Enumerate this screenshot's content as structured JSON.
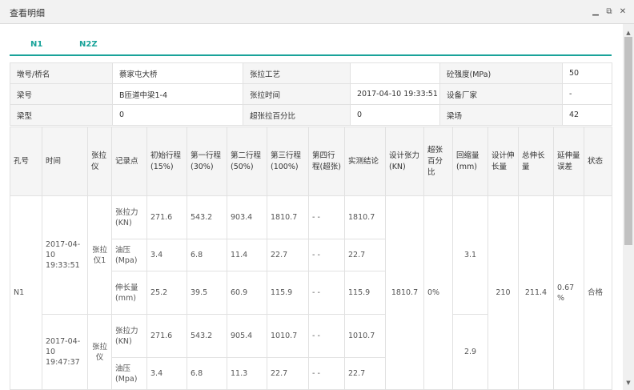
{
  "window": {
    "title": "查看明细",
    "controls": [
      "minimize",
      "maximize",
      "close"
    ]
  },
  "tabs": [
    {
      "label": "N1",
      "active": true
    },
    {
      "label": "N2Z",
      "active": false
    }
  ],
  "info": {
    "row1": {
      "l1": "墩号/桥名",
      "v1": "蔡家屯大桥",
      "l2": "张拉工艺",
      "v2": "",
      "l3": "砼强度(MPa)",
      "v3": "50"
    },
    "row2": {
      "l1": "梁号",
      "v1": "B匝道中梁1-4",
      "l2": "张拉时间",
      "v2": "2017-04-10 19:33:51",
      "l3": "设备厂家",
      "v3": "-"
    },
    "row3": {
      "l1": "梁型",
      "v1": "0",
      "l2": "超张拉百分比",
      "v2": "0",
      "l3": "梁场",
      "v3": "42"
    }
  },
  "headers": {
    "hole": "孔号",
    "time": "时间",
    "device": "张拉仪",
    "point": "记录点",
    "s15": "初始行程(15%)",
    "s30": "第一行程(30%)",
    "s50": "第二行程(50%)",
    "s100": "第三行程(100%)",
    "s4": "第四行程(超张)",
    "measured": "实测结论",
    "design_force": "设计张力(KN)",
    "over_pct": "超张百分比",
    "retract": "回缩量(mm)",
    "design_elong": "设计伸长量",
    "total_elong": "总伸长量",
    "elong_err": "延伸量误差",
    "status": "状态"
  },
  "group": {
    "hole": "N1",
    "design_force": "1810.7",
    "over_pct": "0%",
    "design_elong": "210",
    "total_elong": "211.4",
    "elong_err": "0.67 %",
    "status": "合格",
    "devices": [
      {
        "time": "2017-04-10 19:33:51",
        "name": "张拉仪1",
        "retract": "3.1",
        "rows": [
          {
            "point": "张拉力(KN)",
            "s15": "271.6",
            "s30": "543.2",
            "s50": "903.4",
            "s100": "1810.7",
            "s4": "- -",
            "measured": "1810.7"
          },
          {
            "point": "油压(Mpa)",
            "s15": "3.4",
            "s30": "6.8",
            "s50": "11.4",
            "s100": "22.7",
            "s4": "- -",
            "measured": "22.7"
          },
          {
            "point": "伸长量(mm)",
            "s15": "25.2",
            "s30": "39.5",
            "s50": "60.9",
            "s100": "115.9",
            "s4": "- -",
            "measured": "115.9"
          }
        ]
      },
      {
        "time": "2017-04-10 19:47:37",
        "name": "张拉仪",
        "retract": "2.9",
        "rows": [
          {
            "point": "张拉力(KN)",
            "s15": "271.6",
            "s30": "543.2",
            "s50": "905.4",
            "s100": "1010.7",
            "s4": "- -",
            "measured": "1010.7"
          },
          {
            "point": "油压(Mpa)",
            "s15": "3.4",
            "s30": "6.8",
            "s50": "11.3",
            "s100": "22.7",
            "s4": "- -",
            "measured": "22.7"
          }
        ]
      }
    ]
  },
  "colors": {
    "accent": "#1aa39a",
    "device": "#f0a020",
    "ok": "#1a9e3a",
    "header_bg": "#f5f5f5",
    "border": "#e1e1e1"
  }
}
